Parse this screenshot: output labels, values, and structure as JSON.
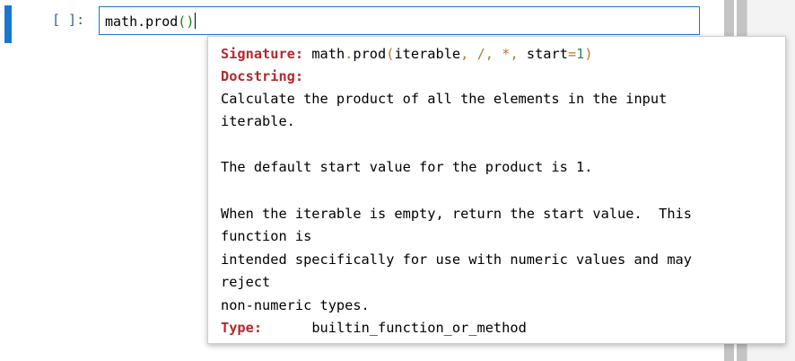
{
  "cell": {
    "prompt": "[ ]:",
    "code_prefix": "math.prod",
    "paren_open": "(",
    "paren_close": ")"
  },
  "tooltip": {
    "signature_label": "Signature:",
    "signature": {
      "name": "math",
      "dot": ".",
      "func": "prod",
      "open": "(",
      "arg1": "iterable",
      "comma1": ",",
      "slash": "/",
      "comma2": ",",
      "star": "*",
      "comma3": ",",
      "kw": "start",
      "eq": "=",
      "default": "1",
      "close": ")"
    },
    "docstring_label": "Docstring:",
    "doc_lines": [
      "Calculate the product of all the elements in the input",
      "iterable.",
      "The default start value for the product is 1.",
      "When the iterable is empty, return the start value.  This",
      "function is",
      "intended specifically for use with numeric values and may",
      "reject",
      "non-numeric types."
    ],
    "type_label": "Type:",
    "type_value": "builtin_function_or_method"
  }
}
